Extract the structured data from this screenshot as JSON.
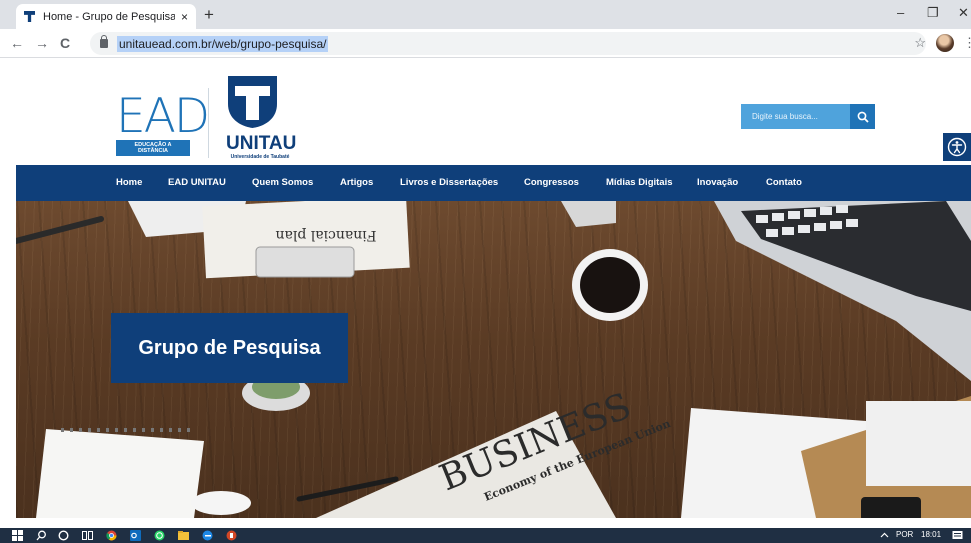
{
  "browser": {
    "tab_title": "Home - Grupo de Pesquisa EAD",
    "tab_close": "×",
    "new_tab": "+",
    "url": "unitauead.com.br/web/grupo-pesquisa/",
    "win_minimize": "–",
    "win_restore": "❐",
    "win_close": "✕",
    "back": "←",
    "forward": "→",
    "reload": "C",
    "bookmark": "☆",
    "menu": "⋮"
  },
  "header": {
    "ead_word": "EAD",
    "ead_badge": "EDUCAÇÃO A DISTÂNCIA",
    "unitau_word": "UNITAU",
    "unitau_sub": "Universidade de Taubaté",
    "search_placeholder": "Digite sua busca..."
  },
  "nav": {
    "items": [
      "Home",
      "EAD UNITAU",
      "Quem Somos",
      "Artigos",
      "Livros e Dissertações",
      "Congressos",
      "Mídias Digitais",
      "Inovação",
      "Contato"
    ]
  },
  "hero": {
    "title": "Grupo de Pesquisa",
    "newspaper_headline": "BUSINESS",
    "newspaper_sub": "Economy of the European Union",
    "notebook_text": "Financial plan"
  },
  "taskbar": {
    "language": "POR",
    "time": "18:01"
  },
  "colors": {
    "brand_dark": "#0f3f7a",
    "brand_blue": "#1f73b7",
    "search_blue": "#4fa3dc"
  }
}
